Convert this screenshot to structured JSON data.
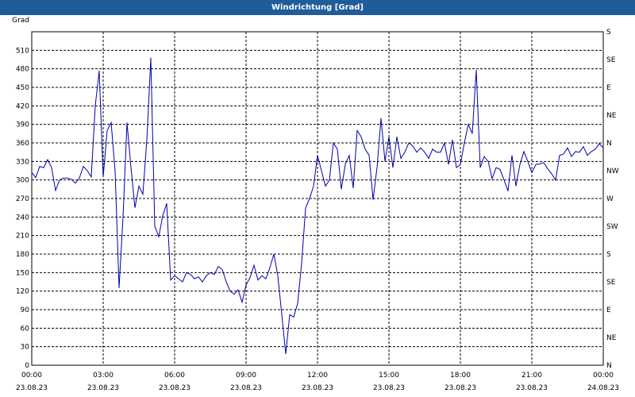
{
  "window_title": "Windrichtung [Grad]",
  "chart_data": {
    "type": "line",
    "title": "Windrichtung [Grad]",
    "ylabel": "Grad",
    "ylim": [
      0,
      540
    ],
    "yticks": [
      0,
      30,
      60,
      90,
      120,
      150,
      180,
      210,
      240,
      270,
      300,
      330,
      360,
      390,
      420,
      450,
      480,
      510
    ],
    "y2ticks": [
      {
        "value": 0,
        "label": "N"
      },
      {
        "value": 45,
        "label": "NE"
      },
      {
        "value": 90,
        "label": "E"
      },
      {
        "value": 135,
        "label": "SE"
      },
      {
        "value": 180,
        "label": "S"
      },
      {
        "value": 225,
        "label": "SW"
      },
      {
        "value": 270,
        "label": "W"
      },
      {
        "value": 315,
        "label": "NW"
      },
      {
        "value": 360,
        "label": "N"
      },
      {
        "value": 405,
        "label": "NE"
      },
      {
        "value": 450,
        "label": "E"
      },
      {
        "value": 495,
        "label": "SE"
      },
      {
        "value": 540,
        "label": "S"
      }
    ],
    "xlim": [
      "23.08.23 00:00",
      "24.08.23 00:00"
    ],
    "xticks": [
      {
        "time": "00:00",
        "date": "23.08.23"
      },
      {
        "time": "03:00",
        "date": "23.08.23"
      },
      {
        "time": "06:00",
        "date": "23.08.23"
      },
      {
        "time": "09:00",
        "date": "23.08.23"
      },
      {
        "time": "12:00",
        "date": "23.08.23"
      },
      {
        "time": "15:00",
        "date": "23.08.23"
      },
      {
        "time": "18:00",
        "date": "23.08.23"
      },
      {
        "time": "21:00",
        "date": "23.08.23"
      },
      {
        "time": "00:00",
        "date": "24.08.23"
      }
    ],
    "grid": true,
    "line_color": "#0000aa",
    "series": [
      {
        "x": [
          "00:00",
          "00:10",
          "00:20",
          "00:30",
          "00:40",
          "00:50",
          "01:00",
          "01:10",
          "01:20",
          "01:30",
          "01:40",
          "01:50",
          "02:00",
          "02:10",
          "02:20",
          "02:30",
          "02:40",
          "02:50",
          "03:00",
          "03:10",
          "03:20",
          "03:30",
          "03:40",
          "03:50",
          "04:00",
          "04:10",
          "04:20",
          "04:30",
          "04:40",
          "04:50",
          "05:00",
          "05:10",
          "05:20",
          "05:30",
          "05:40",
          "05:50",
          "06:00",
          "06:10",
          "06:20",
          "06:30",
          "06:40",
          "06:50",
          "07:00",
          "07:10",
          "07:20",
          "07:30",
          "07:40",
          "07:50",
          "08:00",
          "08:10",
          "08:20",
          "08:30",
          "08:40",
          "08:50",
          "09:00",
          "09:10",
          "09:20",
          "09:30",
          "09:40",
          "09:50",
          "10:00",
          "10:10",
          "10:20",
          "10:30",
          "10:40",
          "10:50",
          "11:00",
          "11:10",
          "11:20",
          "11:30",
          "11:40",
          "11:50",
          "12:00",
          "12:10",
          "12:20",
          "12:30",
          "12:40",
          "12:50",
          "13:00",
          "13:10",
          "13:20",
          "13:30",
          "13:40",
          "13:50",
          "14:00",
          "14:10",
          "14:20",
          "14:30",
          "14:40",
          "14:50",
          "15:00",
          "15:10",
          "15:20",
          "15:30",
          "15:40",
          "15:50",
          "16:00",
          "16:10",
          "16:20",
          "16:30",
          "16:40",
          "16:50",
          "17:00",
          "17:10",
          "17:20",
          "17:30",
          "17:40",
          "17:50",
          "18:00",
          "18:10",
          "18:20",
          "18:30",
          "18:40",
          "18:50",
          "19:00",
          "19:10",
          "19:20",
          "19:30",
          "19:40",
          "19:50",
          "20:00",
          "20:10",
          "20:20",
          "20:30",
          "20:40",
          "20:50",
          "21:00",
          "21:10",
          "21:20",
          "21:30",
          "21:40",
          "21:50",
          "22:00",
          "22:10",
          "22:20",
          "22:30",
          "22:40",
          "22:50",
          "23:00",
          "23:10",
          "23:20",
          "23:30",
          "23:40",
          "23:50",
          "24:00"
        ],
        "y": [
          312,
          304,
          322,
          320,
          333,
          320,
          283,
          300,
          303,
          303,
          301,
          295,
          303,
          322,
          315,
          305,
          420,
          477,
          305,
          380,
          393,
          315,
          125,
          240,
          393,
          320,
          255,
          290,
          277,
          365,
          498,
          225,
          208,
          242,
          262,
          138,
          145,
          140,
          135,
          150,
          147,
          140,
          143,
          135,
          145,
          150,
          147,
          160,
          155,
          135,
          120,
          115,
          122,
          102,
          130,
          142,
          162,
          138,
          145,
          140,
          158,
          180,
          145,
          82,
          18,
          82,
          78,
          100,
          165,
          255,
          270,
          290,
          340,
          315,
          290,
          300,
          360,
          350,
          285,
          325,
          340,
          287,
          380,
          370,
          350,
          340,
          268,
          320,
          400,
          330,
          370,
          320,
          370,
          335,
          345,
          360,
          355,
          345,
          352,
          345,
          335,
          350,
          345,
          345,
          360,
          325,
          365,
          320,
          325,
          360,
          390,
          375,
          478,
          320,
          338,
          330,
          302,
          320,
          317,
          300,
          282,
          340,
          290,
          325,
          346,
          330,
          312,
          325,
          326,
          328,
          318,
          310,
          300,
          340,
          342,
          352,
          338,
          346,
          345,
          354,
          340,
          346,
          350,
          359,
          352
        ]
      }
    ]
  }
}
